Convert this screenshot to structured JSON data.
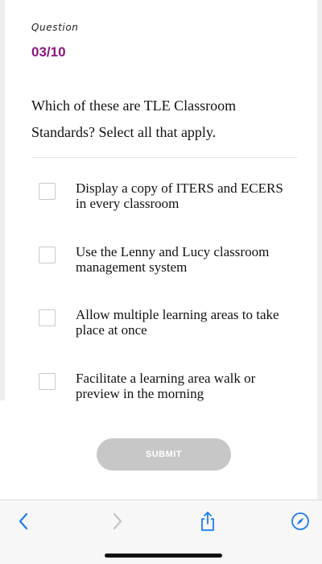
{
  "question": {
    "label": "Question",
    "number": "03/10",
    "text": "Which of these are TLE Classroom Standards? Select all that apply."
  },
  "options": [
    {
      "label": "Display a copy of ITERS and ECERS in every classroom",
      "checked": false
    },
    {
      "label": "Use the Lenny and Lucy classroom management system",
      "checked": false
    },
    {
      "label": "Allow multiple learning areas to take place at once",
      "checked": false
    },
    {
      "label": "Facilitate a learning area walk or preview in the morning",
      "checked": false
    }
  ],
  "submit": {
    "label": "SUBMIT",
    "enabled": false
  },
  "toolbar": {
    "back_icon": "chevron-left-icon",
    "forward_icon": "chevron-right-icon",
    "share_icon": "share-icon",
    "browser_icon": "compass-icon"
  },
  "colors": {
    "accent": "#8a1780",
    "toolbar_blue": "#1a7cf2",
    "submit_disabled": "#c7c7c7"
  }
}
